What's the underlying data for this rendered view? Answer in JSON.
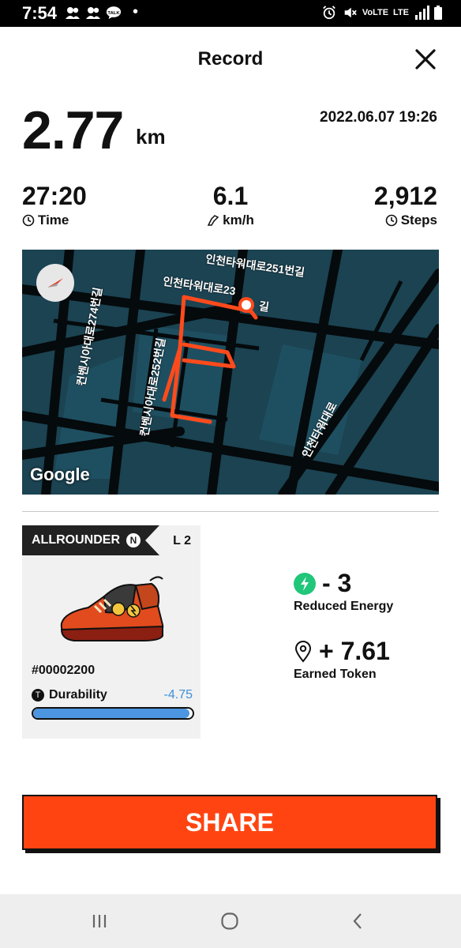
{
  "status_bar": {
    "time": "7:54",
    "left_icons": [
      "people-icon",
      "people-icon",
      "talk-icon"
    ],
    "talk_badge": "TALK",
    "dot": "•",
    "right_icons": [
      "alarm-icon",
      "mute-icon",
      "volte-icon",
      "lte-icon",
      "signal-icon",
      "battery-icon"
    ],
    "volte_text": "VoLTE",
    "lte_text": "LTE"
  },
  "header": {
    "title": "Record",
    "close_icon": "close-icon"
  },
  "summary": {
    "distance": "2.77",
    "distance_unit": "km",
    "datetime": "2022.06.07 19:26"
  },
  "stats": {
    "time": {
      "value": "27:20",
      "label": "Time",
      "icon": "clock-icon"
    },
    "speed": {
      "value": "6.1",
      "label": "km/h",
      "icon": "shoe-speed-icon"
    },
    "steps": {
      "value": "2,912",
      "label": "Steps",
      "icon": "steps-icon"
    }
  },
  "map": {
    "labels": {
      "road1": "인천타워대로251번길",
      "road2": "인천타워대로23",
      "road2_tail": "길",
      "road3": "컨벤시아대로274번길",
      "road4": "컨벤시아대로252번길",
      "road5": "인천타워대로"
    },
    "provider": "Google",
    "route_color": "#ff4a1c",
    "compass_icon": "compass-icon"
  },
  "sneaker": {
    "type": "ALLROUNDER",
    "type_mark": "N",
    "level": "L 2",
    "token_id": "#00002200",
    "durability_label": "Durability",
    "durability_icon_letter": "T",
    "durability_change": "-4.75",
    "durability_fraction": 0.98
  },
  "rewards": {
    "energy": {
      "value": "- 3",
      "label": "Reduced Energy",
      "icon": "energy-bolt-icon",
      "color": "#21c67a"
    },
    "token": {
      "value": "+ 7.61",
      "label": "Earned Token",
      "icon": "location-pin-icon"
    }
  },
  "share_button": {
    "label": "SHARE",
    "color": "#ff4411"
  },
  "nav_bar": {
    "icons": [
      "recents-icon",
      "home-icon",
      "back-icon"
    ]
  }
}
